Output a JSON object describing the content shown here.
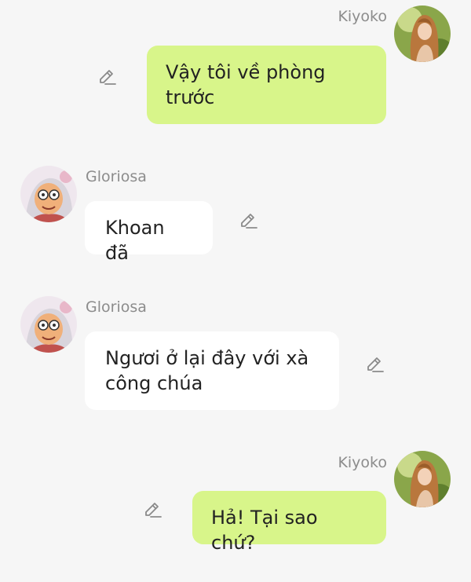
{
  "messages": [
    {
      "sender": "Kiyoko",
      "side": "right",
      "text": "Vậy tôi về phòng trước",
      "avatar_icon": "kiyoko-avatar"
    },
    {
      "sender": "Gloriosa",
      "side": "left",
      "text": "Khoan đã",
      "avatar_icon": "gloriosa-avatar"
    },
    {
      "sender": "Gloriosa",
      "side": "left",
      "text": "Ngươi ở lại đây với xà công chúa",
      "avatar_icon": "gloriosa-avatar"
    },
    {
      "sender": "Kiyoko",
      "side": "right",
      "text": "Hả! Tại sao chứ?",
      "avatar_icon": "kiyoko-avatar"
    }
  ],
  "icons": {
    "edit": "pencil-edit-icon"
  },
  "colors": {
    "background": "#f6f6f6",
    "my_bubble": "#d8f58a",
    "their_bubble": "#ffffff",
    "name_text": "#8c8c8c",
    "message_text": "#222222"
  }
}
